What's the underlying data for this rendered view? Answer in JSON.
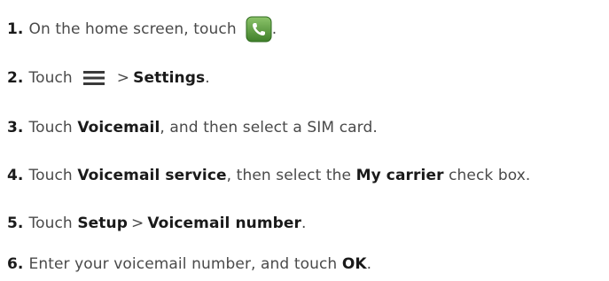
{
  "steps": [
    {
      "num": "1.",
      "text_a": "On the home screen, touch",
      "text_b": "."
    },
    {
      "num": "2.",
      "text_a": "Touch",
      "sep": ">",
      "bold_a": "Settings",
      "text_b": "."
    },
    {
      "num": "3.",
      "text_a": "Touch",
      "bold_a": "Voicemail",
      "text_b": ", and then select a SIM card."
    },
    {
      "num": "4.",
      "text_a": "Touch",
      "bold_a": "Voicemail service",
      "text_b": ", then select the",
      "bold_b": "My carrier",
      "text_c": "check box."
    },
    {
      "num": "5.",
      "text_a": "Touch",
      "bold_a": "Setup",
      "sep": ">",
      "bold_b": "Voicemail number",
      "text_b": "."
    },
    {
      "num": "6.",
      "text_a": "Enter your voicemail number, and touch",
      "bold_a": "OK",
      "text_b": "."
    }
  ],
  "icons": {
    "phone": "phone-app-icon",
    "menu": "menu-icon",
    "phone_bg": "#5a9a3c",
    "phone_fg": "#ffffff"
  }
}
